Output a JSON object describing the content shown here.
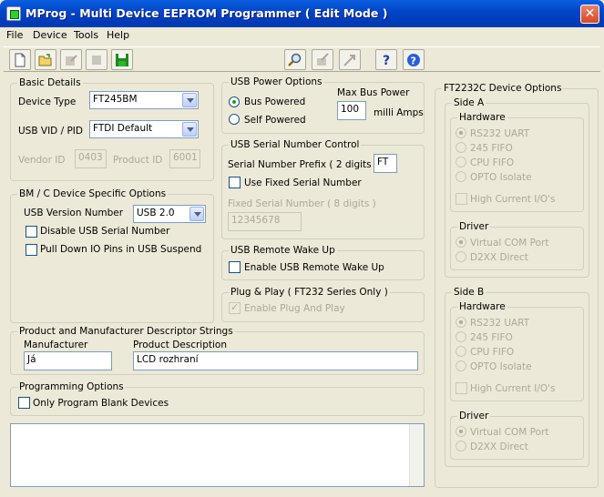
{
  "window": {
    "title": "MProg - Multi Device EEPROM Programmer ( Edit Mode )"
  },
  "menu": [
    "File",
    "Device",
    "Tools",
    "Help"
  ],
  "toolbar": {
    "icons": [
      "new-file-icon",
      "open-folder-icon",
      "edit-icon",
      "stop-icon",
      "save-icon",
      "search-icon",
      "program-icon",
      "flash-icon",
      "help-icon",
      "about-icon"
    ]
  },
  "basic": {
    "caption": "Basic Details",
    "device_type_label": "Device Type",
    "device_type": "FT245BM",
    "vidpid_label": "USB VID / PID",
    "vidpid": "FTDI Default",
    "vendor_id_label": "Vendor ID",
    "vendor_id": "0403",
    "product_id_label": "Product ID",
    "product_id": "6001"
  },
  "bm": {
    "caption": "BM / C Device Specific Options",
    "usb_version_label": "USB Version Number",
    "usb_version": "USB 2.0",
    "disable_serial": "Disable USB Serial Number",
    "pull_down": "Pull Down IO Pins in USB Suspend"
  },
  "power": {
    "caption": "USB Power Options",
    "bus_powered": "Bus Powered",
    "self_powered": "Self Powered",
    "max_label": "Max Bus Power",
    "max_value": "100",
    "units": "milli Amps"
  },
  "serial": {
    "caption": "USB Serial Number Control",
    "prefix_label": "Serial Number Prefix ( 2 digits )",
    "prefix": "FT",
    "use_fixed": "Use Fixed Serial Number",
    "fixed_label": "Fixed Serial Number ( 8 digits )",
    "fixed": "12345678"
  },
  "wake": {
    "caption": "USB Remote Wake Up",
    "enable": "Enable USB Remote Wake Up"
  },
  "pnp": {
    "caption": "Plug & Play  ( FT232 Series Only )",
    "enable": "Enable Plug And Play"
  },
  "strings": {
    "caption": "Product and Manufacturer Descriptor Strings",
    "manufacturer_label": "Manufacturer",
    "manufacturer": "Já",
    "product_label": "Product Description",
    "product": "LCD rozhraní"
  },
  "prog": {
    "caption": "Programming Options",
    "blank_only": "Only Program Blank Devices"
  },
  "ft2232": {
    "caption": "FT2232C Device Options",
    "side_a": "Side A",
    "side_b": "Side B",
    "hardware": "Hardware",
    "hw_options": [
      "RS232 UART",
      "245 FIFO",
      "CPU FIFO",
      "OPTO Isolate"
    ],
    "high_current": "High Current I/O's",
    "driver": "Driver",
    "driver_options": [
      "Virtual COM Port",
      "D2XX Direct"
    ]
  }
}
